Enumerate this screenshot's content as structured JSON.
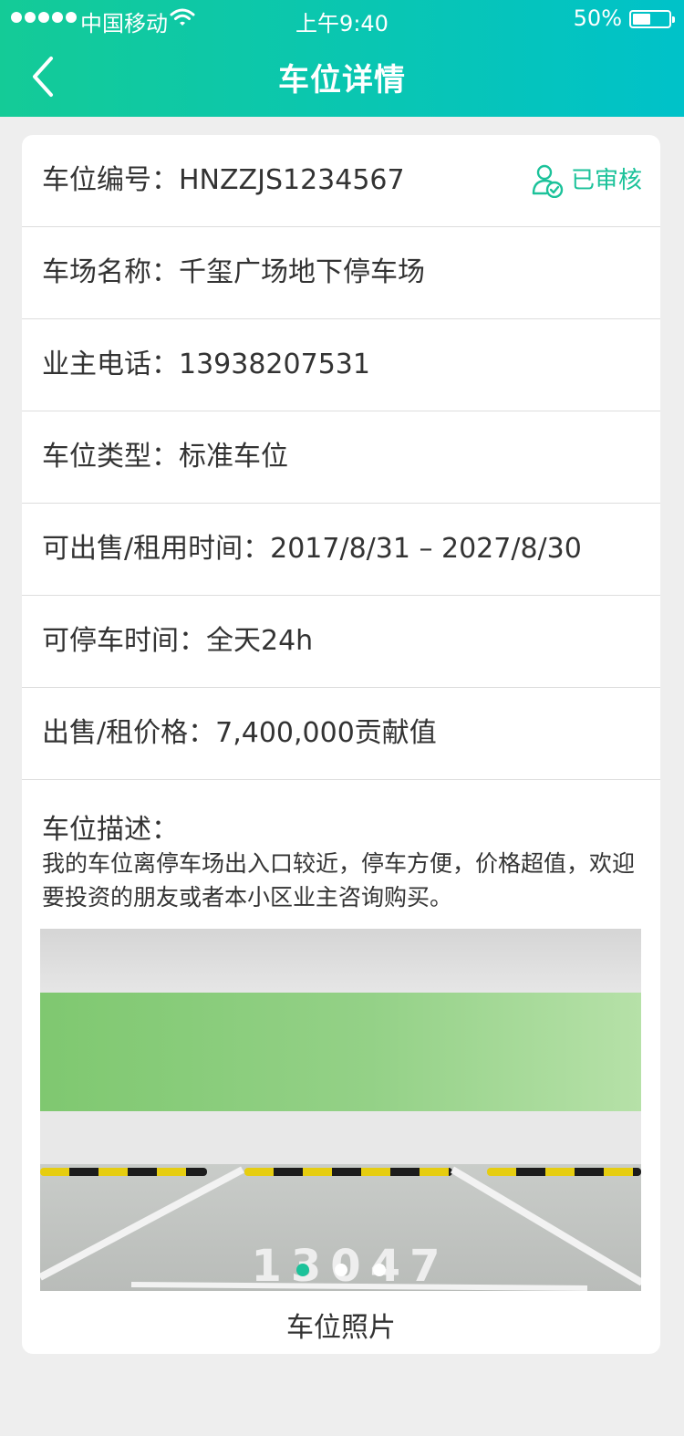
{
  "status_bar": {
    "carrier": "中国移动",
    "time": "上午9:40",
    "battery": "50%",
    "battery_level": 0.5
  },
  "nav": {
    "title": "车位详情",
    "back_icon": "chevron-left-icon"
  },
  "details": {
    "space_no_label": "车位编号：",
    "space_no": "HNZZJS1234567",
    "status": "已审核",
    "lot_name_label": "车场名称：",
    "lot_name": "千玺广场地下停车场",
    "owner_phone_label": "业主电话：",
    "owner_phone": "13938207531",
    "type_label": "车位类型：",
    "type": "标准车位",
    "period_label": "可出售/租用时间：",
    "period": "2017/8/31 – 2027/8/30",
    "parking_time_label": "可停车时间：",
    "parking_time": "全天24h",
    "price_label": "出售/租价格：",
    "price": "7,400,000贡献值"
  },
  "description": {
    "label": "车位描述：",
    "text": "我的车位离停车场出入口较近，停车方便，价格超值，欢迎要投资的朋友或者本小区业主咨询购买。"
  },
  "photo": {
    "floor_number": "13047",
    "caption": "车位照片",
    "total": 3,
    "active_index": 0
  },
  "colors": {
    "accent": "#1cc29a",
    "header_start": "#14cb97",
    "header_end": "#00c2c9"
  }
}
